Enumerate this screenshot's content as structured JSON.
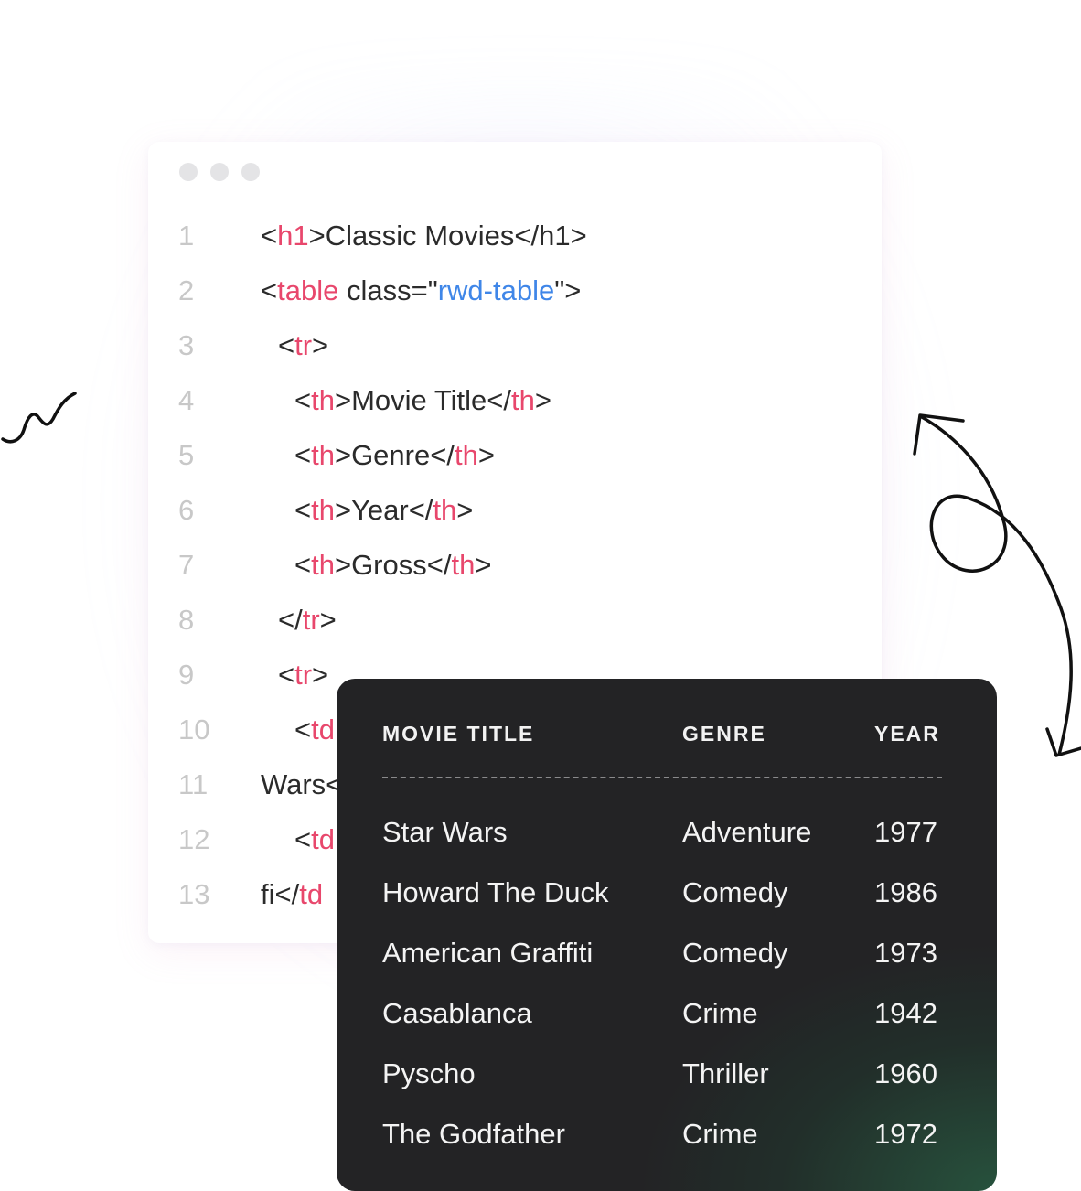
{
  "editor": {
    "lines": [
      {
        "n": "1",
        "parts": [
          [
            "p",
            "<"
          ],
          [
            "t",
            "h1"
          ],
          [
            "p",
            ">Classic Movies</h1>"
          ]
        ]
      },
      {
        "n": "2",
        "parts": [
          [
            "p",
            "<"
          ],
          [
            "t",
            "table"
          ],
          [
            "p",
            " class=\""
          ],
          [
            "v",
            "rwd-table"
          ],
          [
            "p",
            "\">"
          ]
        ]
      },
      {
        "n": "3",
        "parts": [
          [
            "p",
            "<"
          ],
          [
            "t",
            "tr"
          ],
          [
            "p",
            ">"
          ]
        ]
      },
      {
        "n": "4",
        "parts": [
          [
            "p",
            "<"
          ],
          [
            "t",
            "th"
          ],
          [
            "p",
            ">Movie Title</"
          ],
          [
            "t",
            "th"
          ],
          [
            "p",
            ">"
          ]
        ]
      },
      {
        "n": "5",
        "parts": [
          [
            "p",
            "<"
          ],
          [
            "t",
            "th"
          ],
          [
            "p",
            ">Genre</"
          ],
          [
            "t",
            "th"
          ],
          [
            "p",
            ">"
          ]
        ]
      },
      {
        "n": "6",
        "parts": [
          [
            "p",
            "<"
          ],
          [
            "t",
            "th"
          ],
          [
            "p",
            ">Year</"
          ],
          [
            "t",
            "th"
          ],
          [
            "p",
            ">"
          ]
        ]
      },
      {
        "n": "7",
        "parts": [
          [
            "p",
            "<"
          ],
          [
            "t",
            "th"
          ],
          [
            "p",
            ">Gross</"
          ],
          [
            "t",
            "th"
          ],
          [
            "p",
            ">"
          ]
        ]
      },
      {
        "n": "8",
        "parts": [
          [
            "p",
            "</"
          ],
          [
            "t",
            "tr"
          ],
          [
            "p",
            ">"
          ]
        ]
      },
      {
        "n": "9",
        "parts": [
          [
            "p",
            "<"
          ],
          [
            "t",
            "tr"
          ],
          [
            "p",
            ">"
          ]
        ]
      },
      {
        "n": "10",
        "parts": [
          [
            "p",
            "<"
          ],
          [
            "t",
            "td"
          ]
        ]
      },
      {
        "n": "11",
        "parts": [
          [
            "p",
            "Wars<"
          ]
        ]
      },
      {
        "n": "12",
        "parts": [
          [
            "p",
            "<"
          ],
          [
            "t",
            "td"
          ]
        ]
      },
      {
        "n": "13",
        "parts": [
          [
            "p",
            "fi</"
          ],
          [
            "t",
            "td"
          ]
        ]
      }
    ]
  },
  "table": {
    "headers": {
      "title": "MOVIE TITLE",
      "genre": "GENRE",
      "year": "YEAR"
    },
    "rows": [
      {
        "title": "Star Wars",
        "genre": "Adventure",
        "year": "1977"
      },
      {
        "title": "Howard The Duck",
        "genre": "Comedy",
        "year": "1986"
      },
      {
        "title": "American Graffiti",
        "genre": "Comedy",
        "year": "1973"
      },
      {
        "title": "Casablanca",
        "genre": "Crime",
        "year": "1942"
      },
      {
        "title": "Pyscho",
        "genre": "Thriller",
        "year": "1960"
      },
      {
        "title": "The Godfather",
        "genre": "Crime",
        "year": "1972"
      }
    ]
  },
  "colors": {
    "tag": "#e8476c",
    "attr_value": "#3f86e8",
    "card_bg": "#232325",
    "card_accent": "#27543e"
  }
}
